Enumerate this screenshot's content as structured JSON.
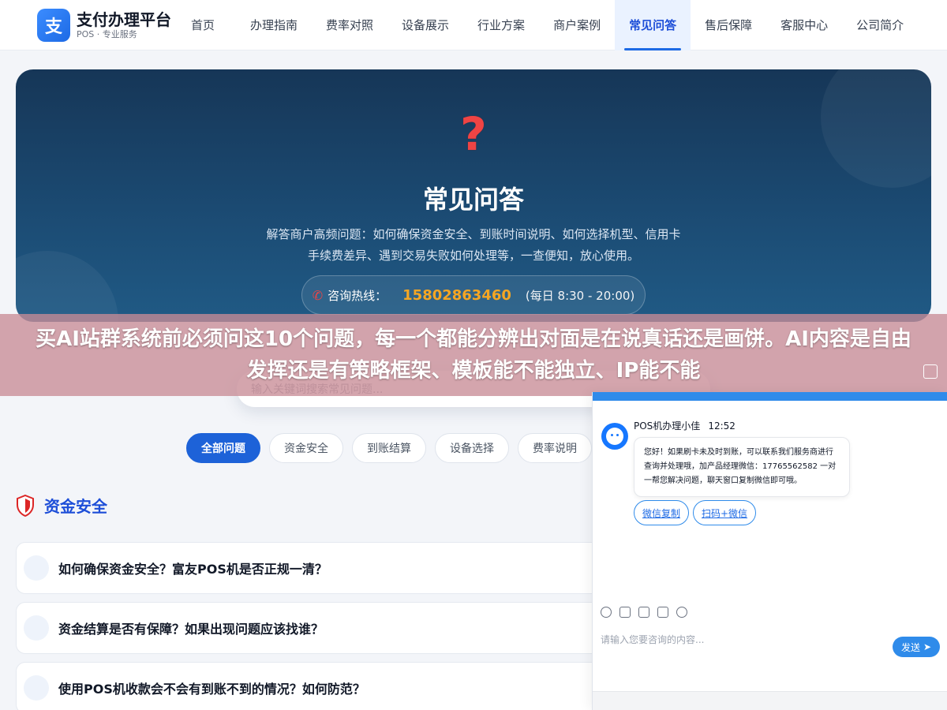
{
  "brand": {
    "logo_char": "支",
    "title": "支付办理平台",
    "subtitle": "POS · 专业服务"
  },
  "nav": [
    "首页",
    "办理指南",
    "费率对照",
    "设备展示",
    "行业方案",
    "商户案例",
    "常见问答",
    "售后保障",
    "客服中心",
    "公司简介"
  ],
  "nav_active": "常见问答",
  "hero": {
    "icon": "question-mark-icon",
    "title": "常见问答",
    "desc_line1": "解答商户高频问题：如何确保资金安全、到账时间说明、如何选择机型、信用卡",
    "desc_line2": "手续费差异、遇到交易失败如何处理等，一查便知，放心使用。",
    "hotline_label": "咨询热线：",
    "hotline_number": "15802863460",
    "hotline_hours": "(每日 8:30 - 20:00)"
  },
  "search": {
    "placeholder": "输入关键词搜索常见问题..."
  },
  "chips": [
    "全部问题",
    "资金安全",
    "到账结算",
    "设备选择",
    "费率说明"
  ],
  "section": {
    "title": "资金安全",
    "icon": "shield-icon"
  },
  "faqs": [
    "如何确保资金安全？富友POS机是否正规一清？",
    "资金结算是否有保障？如果出现问题应该找谁？",
    "使用POS机收款会不会有到账不到的情况？如何防范？"
  ],
  "banner": {
    "text": "买AI站群系统前必须问这10个问题，每一个都能分辨出对面是在说真话还是画饼。AI内容是自由发挥还是有策略框架、模板能不能独立、IP能不能"
  },
  "chat": {
    "agent_name": "POS机办理小佳",
    "time": "12:52",
    "message": "您好！如果刷卡未及时到账，可以联系我们服务商进行查询并处理哦，加产品经理微信：17765562582 一对一帮您解决问题，聊天窗口复制微信即可哦。",
    "quick_buttons": [
      "微信复制",
      "扫码+微信"
    ],
    "input_placeholder": "请输入您要咨询的内容...",
    "send_label": "发送"
  },
  "colors": {
    "primary": "#1d62d8",
    "accent": "#f5a623",
    "hero_bg": "#1b4a72",
    "chat_blue": "#2f8bea"
  }
}
